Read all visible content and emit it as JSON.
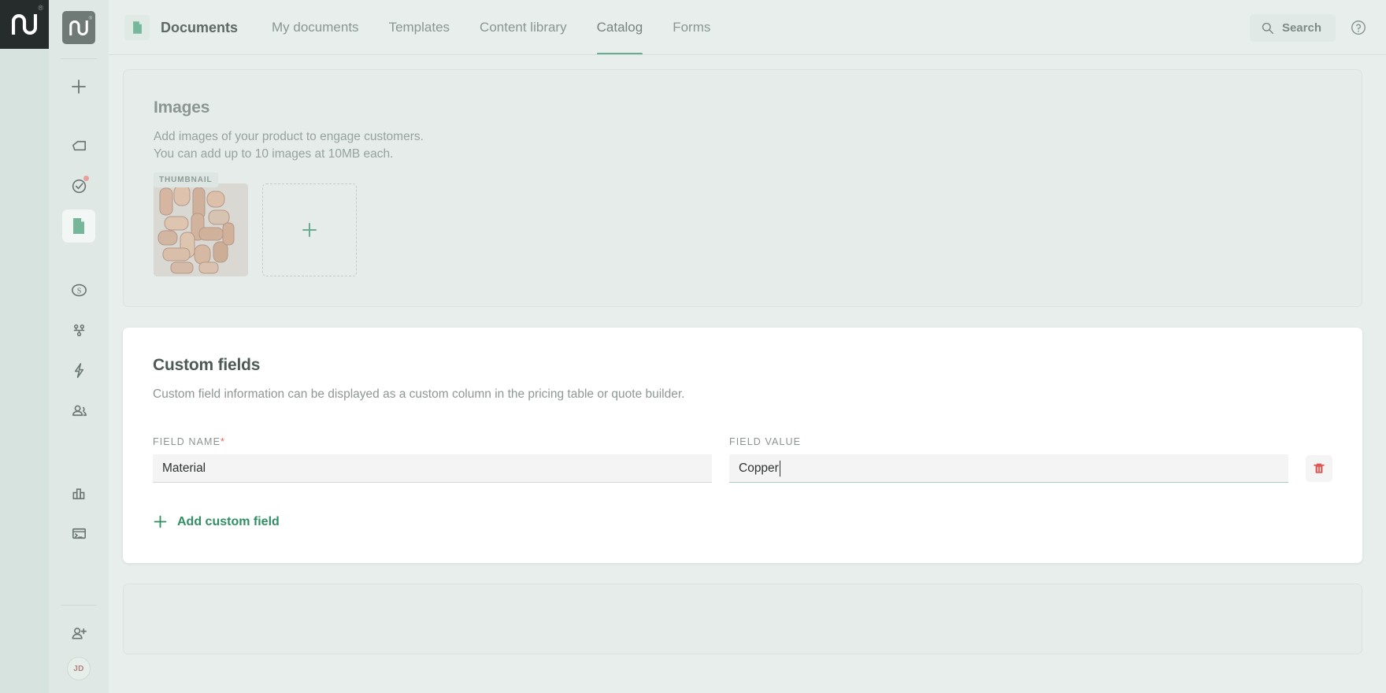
{
  "brand": {
    "logo_text": "pd",
    "registered_mark": "®"
  },
  "sidebar": {
    "items": [
      {
        "name": "create-new",
        "icon": "plus-icon",
        "label": "Create new"
      },
      {
        "name": "home",
        "icon": "home-tag-icon",
        "label": "Home"
      },
      {
        "name": "tasks",
        "icon": "check-circle-icon",
        "label": "Tasks",
        "badge": true
      },
      {
        "name": "documents",
        "icon": "document-icon",
        "label": "Documents",
        "active": true
      },
      {
        "name": "deals",
        "icon": "dollar-circle-icon",
        "label": "Deals"
      },
      {
        "name": "workflows",
        "icon": "workflow-icon",
        "label": "Workflows"
      },
      {
        "name": "automations",
        "icon": "lightning-icon",
        "label": "Automations"
      },
      {
        "name": "contacts",
        "icon": "contacts-icon",
        "label": "Contacts"
      },
      {
        "name": "reports",
        "icon": "bar-chart-icon",
        "label": "Reports"
      },
      {
        "name": "api",
        "icon": "terminal-icon",
        "label": "API"
      },
      {
        "name": "invite",
        "icon": "user-plus-icon",
        "label": "Invite people"
      }
    ],
    "avatar_initials": "JD"
  },
  "header": {
    "app_icon": "document-icon",
    "brand_label": "Documents",
    "tabs": [
      {
        "label": "My documents",
        "active": false
      },
      {
        "label": "Templates",
        "active": false
      },
      {
        "label": "Content library",
        "active": false
      },
      {
        "label": "Catalog",
        "active": true
      },
      {
        "label": "Forms",
        "active": false
      }
    ],
    "search_label": "Search",
    "search_icon": "search-icon",
    "help_icon": "help-circle-icon"
  },
  "images_section": {
    "title": "Images",
    "description_line1": "Add images of your product to engage customers.",
    "description_line2": "You can add up to 10 images at 10MB each.",
    "thumbnail_badge": "THUMBNAIL",
    "add_image_icon": "plus-icon"
  },
  "custom_fields_section": {
    "title": "Custom fields",
    "description": "Custom field information can be displayed as a custom column in the pricing table or quote builder.",
    "field_name_label": "FIELD NAME",
    "field_name_required_marker": "*",
    "field_value_label": "FIELD VALUE",
    "rows": [
      {
        "field_name": "Material",
        "field_value": "Copper",
        "focused": "value",
        "delete_icon": "trash-icon"
      }
    ],
    "add_label": "Add custom field",
    "add_icon": "plus-icon"
  },
  "colors": {
    "page_bg": "#e7eeeb",
    "rail_bg": "#dfe8e4",
    "accent_green": "#2f8f63",
    "tab_active": "#6aab92",
    "danger_red": "#e05650",
    "required_red": "#e8615a"
  }
}
